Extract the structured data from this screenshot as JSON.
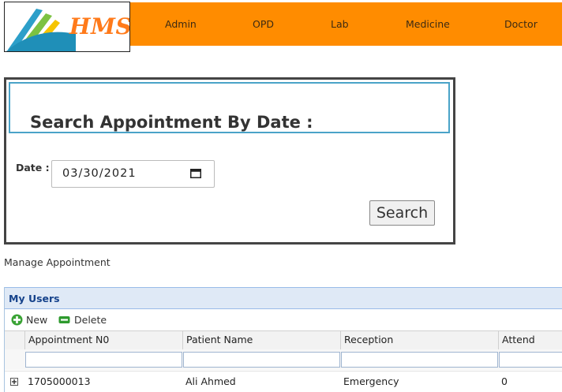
{
  "logo": {
    "text": "HMS"
  },
  "nav": {
    "items": [
      "Admin",
      "OPD",
      "Lab",
      "Medicine",
      "Doctor"
    ]
  },
  "search": {
    "title": "Search Appointment By Date :",
    "date_label": "Date :",
    "date_value": "03/30/2021",
    "button_label": "Search"
  },
  "manage_label": "Manage Appointment",
  "grid": {
    "title": "My Users",
    "toolbar": {
      "new_label": "New",
      "delete_label": "Delete"
    },
    "columns": [
      "Appointment N0",
      "Patient Name",
      "Reception",
      "Attend"
    ],
    "rows": [
      {
        "appointment_no": "1705000013",
        "patient_name": "Ali Ahmed",
        "reception": "Emergency",
        "attend": "0"
      }
    ]
  },
  "colors": {
    "nav_bg": "#ff8c00",
    "logo_text": "#ff7a1a",
    "grid_title": "#15428b",
    "panel_header_border": "#4aa3c8"
  },
  "icons": [
    "calendar-icon",
    "add-icon",
    "delete-icon",
    "expand-icon"
  ]
}
